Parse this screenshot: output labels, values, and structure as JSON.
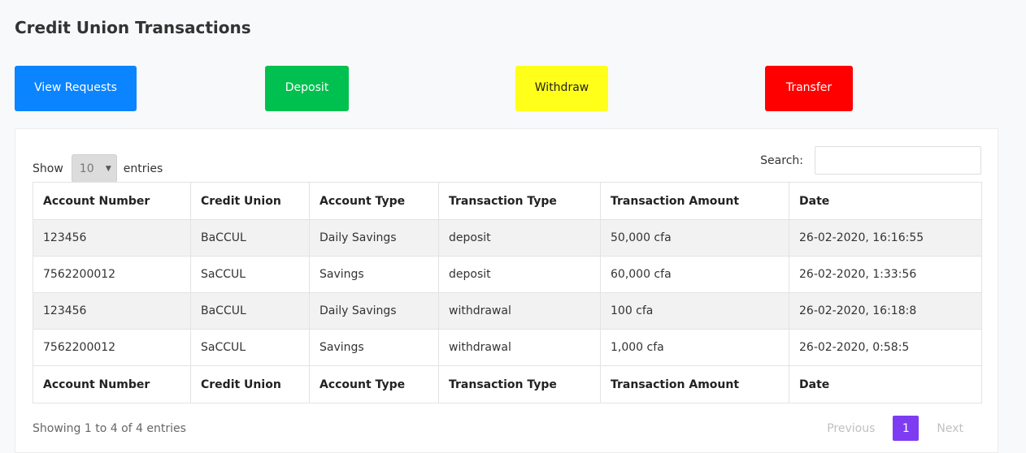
{
  "page": {
    "title": "Credit Union Transactions"
  },
  "actions": [
    {
      "label": "View Requests",
      "bg": "#0a84ff",
      "fg": "#ffffff"
    },
    {
      "label": "Deposit",
      "bg": "#00c04f",
      "fg": "#ffffff"
    },
    {
      "label": "Withdraw",
      "bg": "#ffff1a",
      "fg": "#222222"
    },
    {
      "label": "Transfer",
      "bg": "#ff0000",
      "fg": "#ffffff"
    }
  ],
  "table_controls": {
    "show_label": "Show",
    "entries_value": "10",
    "entries_label": "entries",
    "search_label": "Search:",
    "search_value": ""
  },
  "table": {
    "columns": [
      "Account Number",
      "Credit Union",
      "Account Type",
      "Transaction Type",
      "Transaction Amount",
      "Date"
    ],
    "rows": [
      [
        "123456",
        "BaCCUL",
        "Daily Savings",
        "deposit",
        "50,000 cfa",
        "26-02-2020, 16:16:55"
      ],
      [
        "7562200012",
        "SaCCUL",
        "Savings",
        "deposit",
        "60,000 cfa",
        "26-02-2020, 1:33:56"
      ],
      [
        "123456",
        "BaCCUL",
        "Daily Savings",
        "withdrawal",
        "100 cfa",
        "26-02-2020, 16:18:8"
      ],
      [
        "7562200012",
        "SaCCUL",
        "Savings",
        "withdrawal",
        "1,000 cfa",
        "26-02-2020, 0:58:5"
      ]
    ]
  },
  "footer": {
    "info": "Showing 1 to 4 of 4 entries",
    "previous": "Previous",
    "current_page": "1",
    "next": "Next",
    "accent": "#7e3cf2"
  }
}
